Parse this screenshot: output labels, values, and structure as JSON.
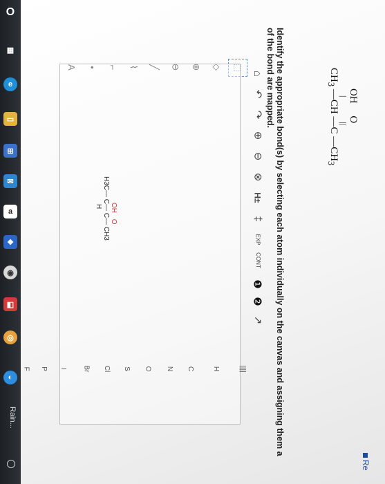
{
  "taskbar": {
    "items": [
      {
        "name": "start-icon",
        "glyph": "O"
      },
      {
        "name": "task-view-icon",
        "glyph": "▦"
      },
      {
        "name": "edge-icon",
        "glyph": "e"
      },
      {
        "name": "file-explorer-icon",
        "glyph": "▭"
      },
      {
        "name": "store-icon",
        "glyph": "⊞"
      },
      {
        "name": "mail-icon",
        "glyph": "✉"
      },
      {
        "name": "amazon-icon",
        "glyph": "a"
      },
      {
        "name": "dropbox-icon",
        "glyph": "❖"
      },
      {
        "name": "camera-icon",
        "glyph": "◉"
      },
      {
        "name": "app-icon",
        "glyph": "◧"
      },
      {
        "name": "chrome-icon",
        "glyph": "◎"
      },
      {
        "name": "edge-2-icon",
        "glyph": "◐"
      }
    ],
    "weather_label": "Rain..."
  },
  "structure_top": {
    "oh": "OH",
    "o": "O",
    "ch3_left": "CH",
    "sub3": "3",
    "ch": "CH",
    "c": "C",
    "ch3_right": "CH"
  },
  "question": {
    "line1": "Identify the appropriate bond(s) by selecting each atom individually on the canvas and assigning them a",
    "line2": "of the bond are mapped."
  },
  "corner_label": "Re",
  "toolbar": {
    "tools": [
      "⌂",
      "↶",
      "↷",
      "⊕",
      "⊖",
      "⊗",
      "H±",
      "‡",
      "EXP",
      "CONT",
      "❶",
      "❷",
      "↗"
    ]
  },
  "left_tools": [
    "⬚",
    "◇",
    "⊕",
    "⊖",
    "╱",
    "⌇",
    "⌐",
    "•",
    "A"
  ],
  "canvas_molecule": {
    "h3c": "H3C",
    "oh": "OH",
    "o": "O",
    "c1": "C",
    "c2": "C",
    "ch3": "CH3",
    "h": "H"
  },
  "periodic": [
    "H",
    "C",
    "N",
    "O",
    "S",
    "Cl",
    "Br",
    "I",
    "P",
    "F"
  ],
  "periodic_menu": "||||"
}
